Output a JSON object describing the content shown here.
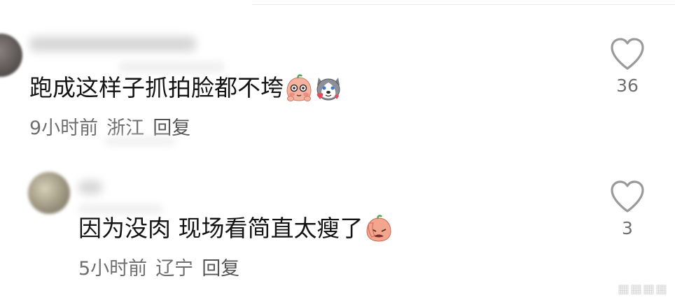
{
  "comments": [
    {
      "text": "跑成这样子抓拍脸都不垮",
      "time": "9小时前",
      "location": "浙江",
      "reply_label": "回复",
      "likes": "36",
      "emojis": [
        "blushing-peach-emoji",
        "husky-dog-emoji"
      ]
    },
    {
      "text": "因为没肉 现场看简直太瘦了",
      "time": "5小时前",
      "location": "辽宁",
      "reply_label": "回复",
      "likes": "3",
      "emojis": [
        "facepalm-peach-emoji"
      ]
    }
  ],
  "icons": {
    "like": "heart-outline-icon"
  },
  "colors": {
    "text": "#141414",
    "meta": "#6f6f6f",
    "heart": "#9a9a9a"
  }
}
